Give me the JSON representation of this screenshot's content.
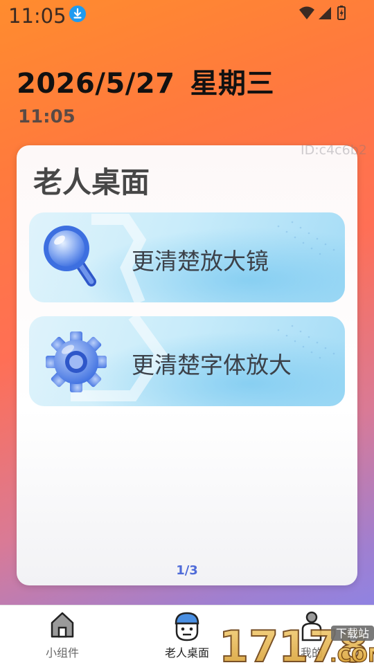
{
  "status_bar": {
    "time": "11:05"
  },
  "header": {
    "date": "2026/5/27",
    "weekday": "星期三",
    "time": "11:05"
  },
  "card": {
    "id_text": "ID:c4c6b2",
    "title": "老人桌面",
    "features": [
      {
        "label": "更清楚放大镜",
        "icon": "magnifier-icon"
      },
      {
        "label": "更清楚字体放大",
        "icon": "gear-icon"
      }
    ],
    "page_indicator": "1/3"
  },
  "nav": {
    "items": [
      {
        "label": "小组件",
        "icon": "home-icon",
        "active": false
      },
      {
        "label": "老人桌面",
        "icon": "elder-face-icon",
        "active": true
      },
      {
        "label": "我的",
        "icon": "person-icon",
        "active": false
      }
    ]
  },
  "watermark": {
    "number": "17178",
    "tag": "下载站",
    "domain": ".COM"
  },
  "colors": {
    "accent": "#4f6bd8",
    "icon_blue": "#3d6fe0",
    "bg_top": "#ff8c2e",
    "bg_bottom": "#7f86f2"
  }
}
